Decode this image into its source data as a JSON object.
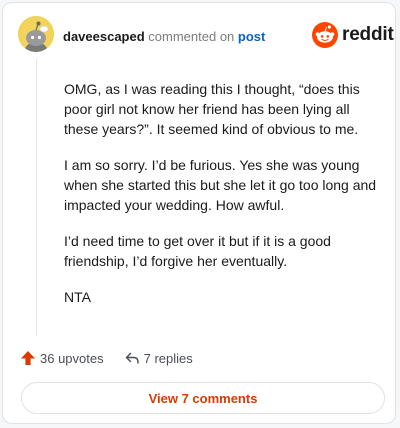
{
  "header": {
    "username": "daveescaped",
    "action_text": "commented on",
    "post_link": "post",
    "logo_text": "reddit"
  },
  "comment": {
    "paragraphs": [
      "OMG, as I was reading this I thought, “does this poor girl not know her friend has been lying all these years?”. It seemed kind of obvious to me.",
      "I am so sorry. I’d be furious. Yes she was young when she started this but she let it go too long and impacted your wedding. How awful.",
      "I’d need time to get over it but if it is a good friendship, I’d forgive her eventually.",
      "NTA"
    ]
  },
  "actions": {
    "upvotes": "36 upvotes",
    "replies": "7 replies"
  },
  "footer": {
    "view_comments": "View 7 comments"
  },
  "colors": {
    "accent": "#d93a00",
    "link": "#0a63c7",
    "avatar_bg": "#f2d35c"
  }
}
